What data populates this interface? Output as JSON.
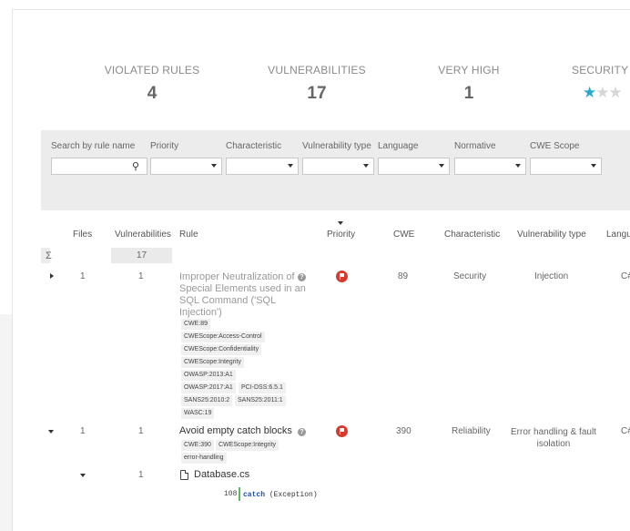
{
  "kpis": {
    "violated_rules": {
      "label": "VIOLATED RULES",
      "value": "4"
    },
    "vulnerabilities": {
      "label": "VULNERABILITIES",
      "value": "17"
    },
    "very_high": {
      "label": "VERY HIGH",
      "value": "1"
    },
    "security": {
      "label": "SECURITY",
      "stars_filled": 1,
      "stars_total": 3
    }
  },
  "filters": {
    "search_label": "Search by rule name",
    "priority_label": "Priority",
    "characteristic_label": "Characteristic",
    "vuln_type_label": "Vulnerability type",
    "language_label": "Language",
    "normative_label": "Normative",
    "cwe_scope_label": "CWE Scope"
  },
  "table": {
    "headers": {
      "files": "Files",
      "vulnerabilities": "Vulnerabilities",
      "rule": "Rule",
      "priority": "Priority",
      "cwe": "CWE",
      "characteristic": "Characteristic",
      "vuln_type": "Vulnerability type",
      "language": "Langu"
    },
    "sum": {
      "symbol": "Σ",
      "vulnerabilities": "17"
    },
    "rows": [
      {
        "files": "1",
        "vulnerabilities": "1",
        "rule_lines": [
          "Improper Neutralization of",
          "Special Elements used in an",
          "SQL Command ('SQL",
          "Injection')"
        ],
        "tags": [
          "CWE:89",
          "CWEScope:Access-Control",
          "CWEScope:Confidentiality",
          "CWEScope:Integrity",
          "OWASP:2013:A1",
          "OWASP:2017:A1",
          "PCI-DSS:6.5.1",
          "SANS25:2010:2",
          "SANS25:2011:1",
          "WASC:19"
        ],
        "cwe": "89",
        "characteristic": "Security",
        "vuln_type": "Injection",
        "language": "C#"
      },
      {
        "files": "1",
        "vulnerabilities": "1",
        "rule_lines": [
          "Avoid empty catch blocks"
        ],
        "tags": [
          "CWE:390",
          "CWEScope:Integrity",
          "error-handling"
        ],
        "cwe": "390",
        "characteristic": "Reliability",
        "vuln_type_lines": [
          "Error handling & fault",
          "isolation"
        ],
        "language": "C#"
      }
    ],
    "file_row": {
      "vulnerabilities": "1",
      "file_name": "Database.cs",
      "line_no": "108",
      "code_kw": "catch",
      "code_rest": " (Exception)"
    }
  }
}
